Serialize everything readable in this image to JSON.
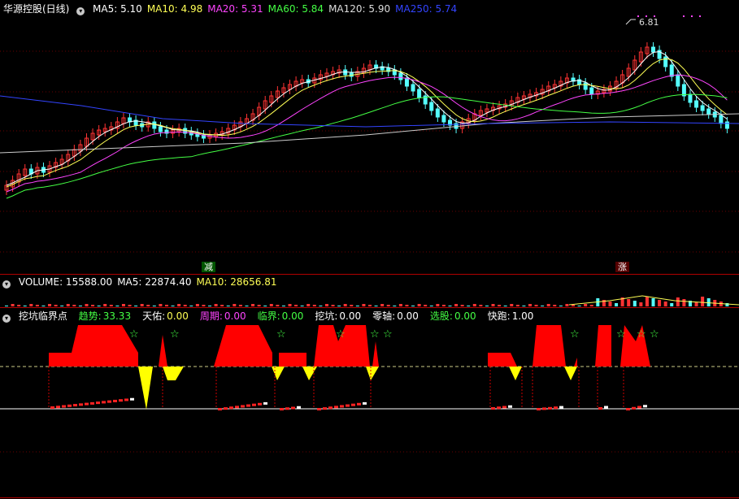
{
  "main_panel": {
    "title": "华源控股(日线)",
    "ma": [
      {
        "label": "MA5: 5.10",
        "color": "#ffffff"
      },
      {
        "label": "MA10: 4.98",
        "color": "#ffff55"
      },
      {
        "label": "MA20: 5.31",
        "color": "#ff44ff"
      },
      {
        "label": "MA60: 5.84",
        "color": "#44ff44"
      },
      {
        "label": "MA120: 5.90",
        "color": "#dddddd"
      },
      {
        "label": "MA250: 5.74",
        "color": "#3344ff"
      }
    ],
    "high_label": "6.81",
    "marker_left": "减",
    "marker_right": "涨"
  },
  "volume_panel": {
    "labels": [
      {
        "label": "VOLUME: 15588.00",
        "color": "#ffffff"
      },
      {
        "label": "MA5: 22874.40",
        "color": "#ffffff"
      },
      {
        "label": "MA10: 28656.81",
        "color": "#ffff55"
      }
    ]
  },
  "indicator_panel": {
    "title": "挖坑临界点",
    "fields": [
      {
        "name": "趋势:",
        "value": "33.33",
        "name_color": "#44ff44",
        "value_color": "#44ff44"
      },
      {
        "name": "天佑:",
        "value": "0.00",
        "name_color": "#ffffff",
        "value_color": "#ffff55"
      },
      {
        "name": "周期:",
        "value": "0.00",
        "name_color": "#ff44ff",
        "value_color": "#ff44ff"
      },
      {
        "name": "临界:",
        "value": "0.00",
        "name_color": "#44ff44",
        "value_color": "#44ff44"
      },
      {
        "name": "挖坑:",
        "value": "0.00",
        "name_color": "#ffffff",
        "value_color": "#ffffff"
      },
      {
        "name": "零轴:",
        "value": "0.00",
        "name_color": "#ffffff",
        "value_color": "#ffffff"
      },
      {
        "name": "选股:",
        "value": "0.00",
        "name_color": "#44ff44",
        "value_color": "#44ff44"
      },
      {
        "name": "快跑:",
        "value": "1.00",
        "name_color": "#ffffff",
        "value_color": "#ffffff"
      }
    ]
  },
  "colors": {
    "up": "#ff3333",
    "down": "#55ffff",
    "separator": "#b00000",
    "grid": "#7a0000"
  }
}
